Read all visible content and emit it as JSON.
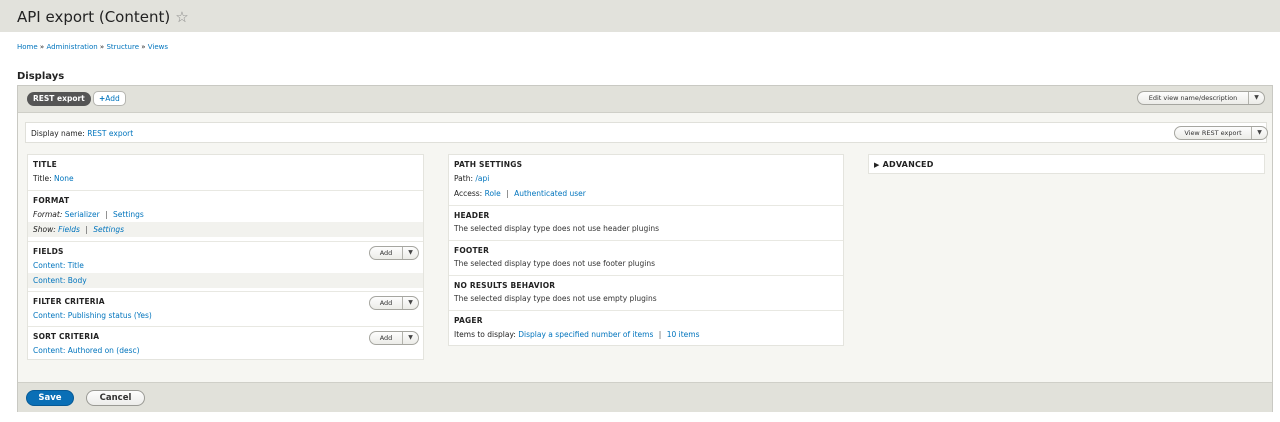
{
  "header": {
    "title": "API export (Content)",
    "star_icon": "☆"
  },
  "breadcrumb": {
    "items": [
      "Home",
      "Administration",
      "Structure",
      "Views"
    ],
    "separator": "»"
  },
  "displays": {
    "label": "Displays",
    "active_tab": "REST export",
    "add_tab": "Add",
    "edit_button": "Edit view name/description"
  },
  "display_panel": {
    "name_label": "Display name:",
    "name_value": "REST export",
    "view_button": "View REST export"
  },
  "left_column": {
    "title": {
      "heading": "TITLE",
      "label": "Title:",
      "value": "None"
    },
    "format": {
      "heading": "FORMAT",
      "format_label": "Format:",
      "format_value": "Serializer",
      "format_settings": "Settings",
      "show_label": "Show:",
      "show_value": "Fields",
      "show_settings": "Settings"
    },
    "fields": {
      "heading": "FIELDS",
      "add_label": "Add",
      "items": [
        "Content: Title",
        "Content: Body"
      ]
    },
    "filter_criteria": {
      "heading": "FILTER CRITERIA",
      "add_label": "Add",
      "items": [
        "Content: Publishing status (Yes)"
      ]
    },
    "sort_criteria": {
      "heading": "SORT CRITERIA",
      "add_label": "Add",
      "items": [
        "Content: Authored on (desc)"
      ]
    }
  },
  "middle_column": {
    "path_settings": {
      "heading": "PATH SETTINGS",
      "path_label": "Path:",
      "path_value": "/api",
      "access_label": "Access:",
      "access_role": "Role",
      "access_value": "Authenticated user"
    },
    "header": {
      "heading": "HEADER",
      "note": "The selected display type does not use header plugins"
    },
    "footer": {
      "heading": "FOOTER",
      "note": "The selected display type does not use footer plugins"
    },
    "no_results": {
      "heading": "NO RESULTS BEHAVIOR",
      "note": "The selected display type does not use empty plugins"
    },
    "pager": {
      "heading": "PAGER",
      "items_label": "Items to display:",
      "items_value": "Display a specified number of items",
      "items_count": "10 items"
    }
  },
  "advanced": {
    "label": "ADVANCED",
    "toggle_icon": "▶"
  },
  "actions": {
    "save": "Save",
    "cancel": "Cancel"
  },
  "colors": {
    "link": "#0074bd",
    "primary_button": "#0a6fb6",
    "header_bg": "#e2e2dc"
  }
}
